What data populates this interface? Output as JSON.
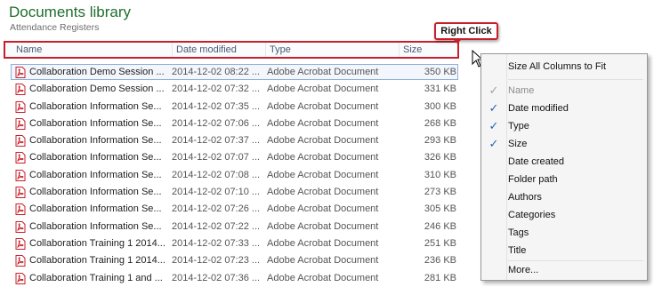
{
  "library": {
    "title": "Documents library",
    "subtitle": "Attendance Registers"
  },
  "callout": {
    "text": "Right Click"
  },
  "columns": [
    "Name",
    "Date modified",
    "Type",
    "Size"
  ],
  "rows": [
    {
      "name": "Collaboration Demo Session ...",
      "date": "2014-12-02 08:22 ...",
      "type": "Adobe Acrobat Document",
      "size": "350 KB"
    },
    {
      "name": "Collaboration Demo Session ...",
      "date": "2014-12-02 07:32 ...",
      "type": "Adobe Acrobat Document",
      "size": "331 KB"
    },
    {
      "name": "Collaboration Information Se...",
      "date": "2014-12-02 07:35 ...",
      "type": "Adobe Acrobat Document",
      "size": "300 KB"
    },
    {
      "name": "Collaboration Information Se...",
      "date": "2014-12-02 07:06 ...",
      "type": "Adobe Acrobat Document",
      "size": "268 KB"
    },
    {
      "name": "Collaboration Information Se...",
      "date": "2014-12-02 07:37 ...",
      "type": "Adobe Acrobat Document",
      "size": "293 KB"
    },
    {
      "name": "Collaboration Information Se...",
      "date": "2014-12-02 07:07 ...",
      "type": "Adobe Acrobat Document",
      "size": "326 KB"
    },
    {
      "name": "Collaboration Information Se...",
      "date": "2014-12-02 07:08 ...",
      "type": "Adobe Acrobat Document",
      "size": "310 KB"
    },
    {
      "name": "Collaboration Information Se...",
      "date": "2014-12-02 07:10 ...",
      "type": "Adobe Acrobat Document",
      "size": "273 KB"
    },
    {
      "name": "Collaboration Information Se...",
      "date": "2014-12-02 07:26 ...",
      "type": "Adobe Acrobat Document",
      "size": "305 KB"
    },
    {
      "name": "Collaboration Information Se...",
      "date": "2014-12-02 07:22 ...",
      "type": "Adobe Acrobat Document",
      "size": "246 KB"
    },
    {
      "name": "Collaboration Training 1 2014...",
      "date": "2014-12-02 07:33 ...",
      "type": "Adobe Acrobat Document",
      "size": "251 KB"
    },
    {
      "name": "Collaboration Training 1 2014...",
      "date": "2014-12-02 07:23 ...",
      "type": "Adobe Acrobat Document",
      "size": "236 KB"
    },
    {
      "name": "Collaboration Training 1 and ...",
      "date": "2014-12-02 07:36 ...",
      "type": "Adobe Acrobat Document",
      "size": "281 KB"
    }
  ],
  "context_menu": {
    "size_all": "Size All Columns to Fit",
    "items": [
      {
        "label": "Name",
        "checked": true,
        "disabled": true
      },
      {
        "label": "Date modified",
        "checked": true,
        "disabled": false
      },
      {
        "label": "Type",
        "checked": true,
        "disabled": false
      },
      {
        "label": "Size",
        "checked": true,
        "disabled": false
      },
      {
        "label": "Date created",
        "checked": false,
        "disabled": false
      },
      {
        "label": "Folder path",
        "checked": false,
        "disabled": false
      },
      {
        "label": "Authors",
        "checked": false,
        "disabled": false
      },
      {
        "label": "Categories",
        "checked": false,
        "disabled": false
      },
      {
        "label": "Tags",
        "checked": false,
        "disabled": false
      },
      {
        "label": "Title",
        "checked": false,
        "disabled": false
      }
    ],
    "more": "More..."
  },
  "colors": {
    "title_green": "#1e6e2c",
    "callout_red": "#c8202a",
    "check_blue": "#2b5fb4",
    "pdf_red": "#c8202a"
  },
  "icons": {
    "file_icon": "pdf-icon",
    "menu_check": "check-icon",
    "pointer": "mouse-cursor-icon"
  }
}
